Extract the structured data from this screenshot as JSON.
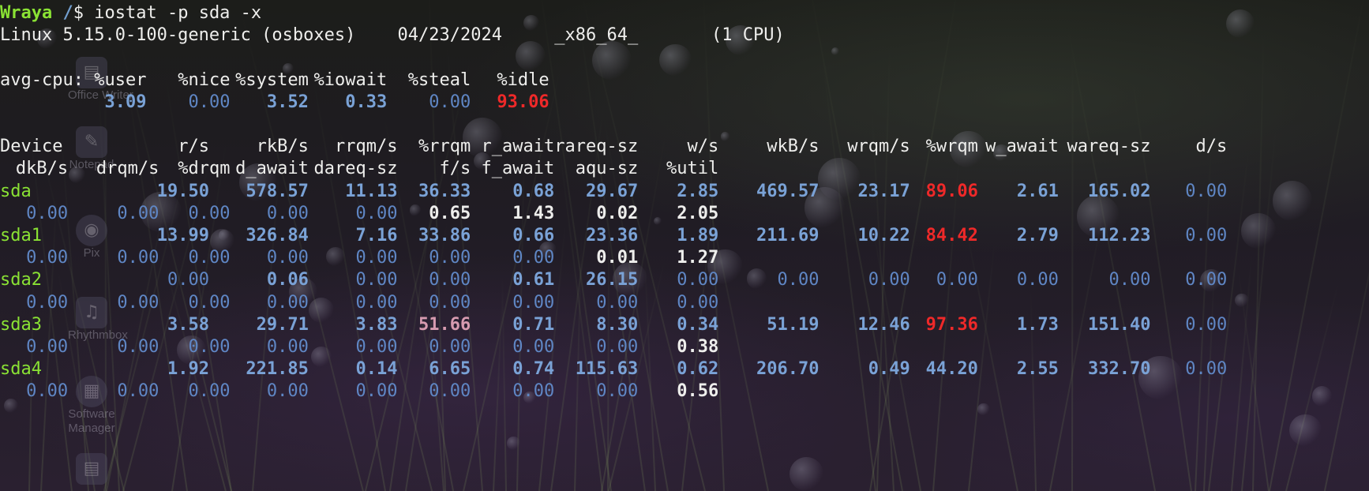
{
  "prompt": {
    "user": "Wraya",
    "path": "/",
    "symbol": "$",
    "command": " iostat -p sda -x"
  },
  "sysinfo": {
    "kernel": "Linux 5.15.0-100-generic (osboxes)",
    "date": "04/23/2024",
    "arch": "_x86_64_",
    "cpus": "(1 CPU)"
  },
  "cpu": {
    "label": "avg-cpu:",
    "headers": [
      "%user",
      "%nice",
      "%system",
      "%iowait",
      "%steal",
      "%idle"
    ],
    "values": [
      "3.09",
      "0.00",
      "3.52",
      "0.33",
      "0.00",
      "93.06"
    ]
  },
  "device_table": {
    "headers_row1": [
      "Device",
      "r/s",
      "rkB/s",
      "rrqm/s",
      "%rrqm",
      "r_await",
      "rareq-sz",
      "w/s",
      "wkB/s",
      "wrqm/s",
      "%wrqm",
      "w_await",
      "wareq-sz",
      "d/s"
    ],
    "headers_row2": [
      "dkB/s",
      "drqm/s",
      "%drqm",
      "d_await",
      "dareq-sz",
      "f/s",
      "f_await",
      "aqu-sz",
      "%util"
    ],
    "rows": [
      {
        "name": "sda",
        "line1": [
          "19.50",
          "578.57",
          "11.13",
          "36.33",
          "0.68",
          "29.67",
          "2.85",
          "469.57",
          "23.17",
          "89.06",
          "2.61",
          "165.02",
          "0.00"
        ],
        "line2": [
          "0.00",
          "0.00",
          "0.00",
          "0.00",
          "0.00",
          "0.65",
          "1.43",
          "0.02",
          "2.05"
        ]
      },
      {
        "name": "sda1",
        "line1": [
          "13.99",
          "326.84",
          "7.16",
          "33.86",
          "0.66",
          "23.36",
          "1.89",
          "211.69",
          "10.22",
          "84.42",
          "2.79",
          "112.23",
          "0.00"
        ],
        "line2": [
          "0.00",
          "0.00",
          "0.00",
          "0.00",
          "0.00",
          "0.00",
          "0.00",
          "0.01",
          "1.27"
        ]
      },
      {
        "name": "sda2",
        "line1": [
          "0.00",
          "0.06",
          "0.00",
          "0.00",
          "0.61",
          "26.15",
          "0.00",
          "0.00",
          "0.00",
          "0.00",
          "0.00",
          "0.00",
          "0.00"
        ],
        "line2": [
          "0.00",
          "0.00",
          "0.00",
          "0.00",
          "0.00",
          "0.00",
          "0.00",
          "0.00",
          "0.00"
        ]
      },
      {
        "name": "sda3",
        "line1": [
          "3.58",
          "29.71",
          "3.83",
          "51.66",
          "0.71",
          "8.30",
          "0.34",
          "51.19",
          "12.46",
          "97.36",
          "1.73",
          "151.40",
          "0.00"
        ],
        "line2": [
          "0.00",
          "0.00",
          "0.00",
          "0.00",
          "0.00",
          "0.00",
          "0.00",
          "0.00",
          "0.38"
        ]
      },
      {
        "name": "sda4",
        "line1": [
          "1.92",
          "221.85",
          "0.14",
          "6.65",
          "0.74",
          "115.63",
          "0.62",
          "206.70",
          "0.49",
          "44.20",
          "2.55",
          "332.70",
          "0.00"
        ],
        "line2": [
          "0.00",
          "0.00",
          "0.00",
          "0.00",
          "0.00",
          "0.00",
          "0.00",
          "0.00",
          "0.56"
        ]
      }
    ]
  },
  "desktop_icons": [
    {
      "label": "Office Writer",
      "icon": "document-icon"
    },
    {
      "label": "Notepad",
      "icon": "notepad-icon"
    },
    {
      "label": "Pix",
      "icon": "image-viewer-icon"
    },
    {
      "label": "Rhythmbox",
      "icon": "music-note-icon"
    },
    {
      "label": "Software Manager",
      "icon": "software-manager-icon"
    },
    {
      "label": "",
      "icon": "file-icon"
    }
  ],
  "colors": {
    "prompt_user": "#8ae234",
    "prompt_path": "#729fcf",
    "value_blue": "#7aa2d6",
    "value_dim": "#5f86c4",
    "value_red": "#ef2929",
    "value_pink": "#d79bb0",
    "device_green": "#8ae234"
  }
}
